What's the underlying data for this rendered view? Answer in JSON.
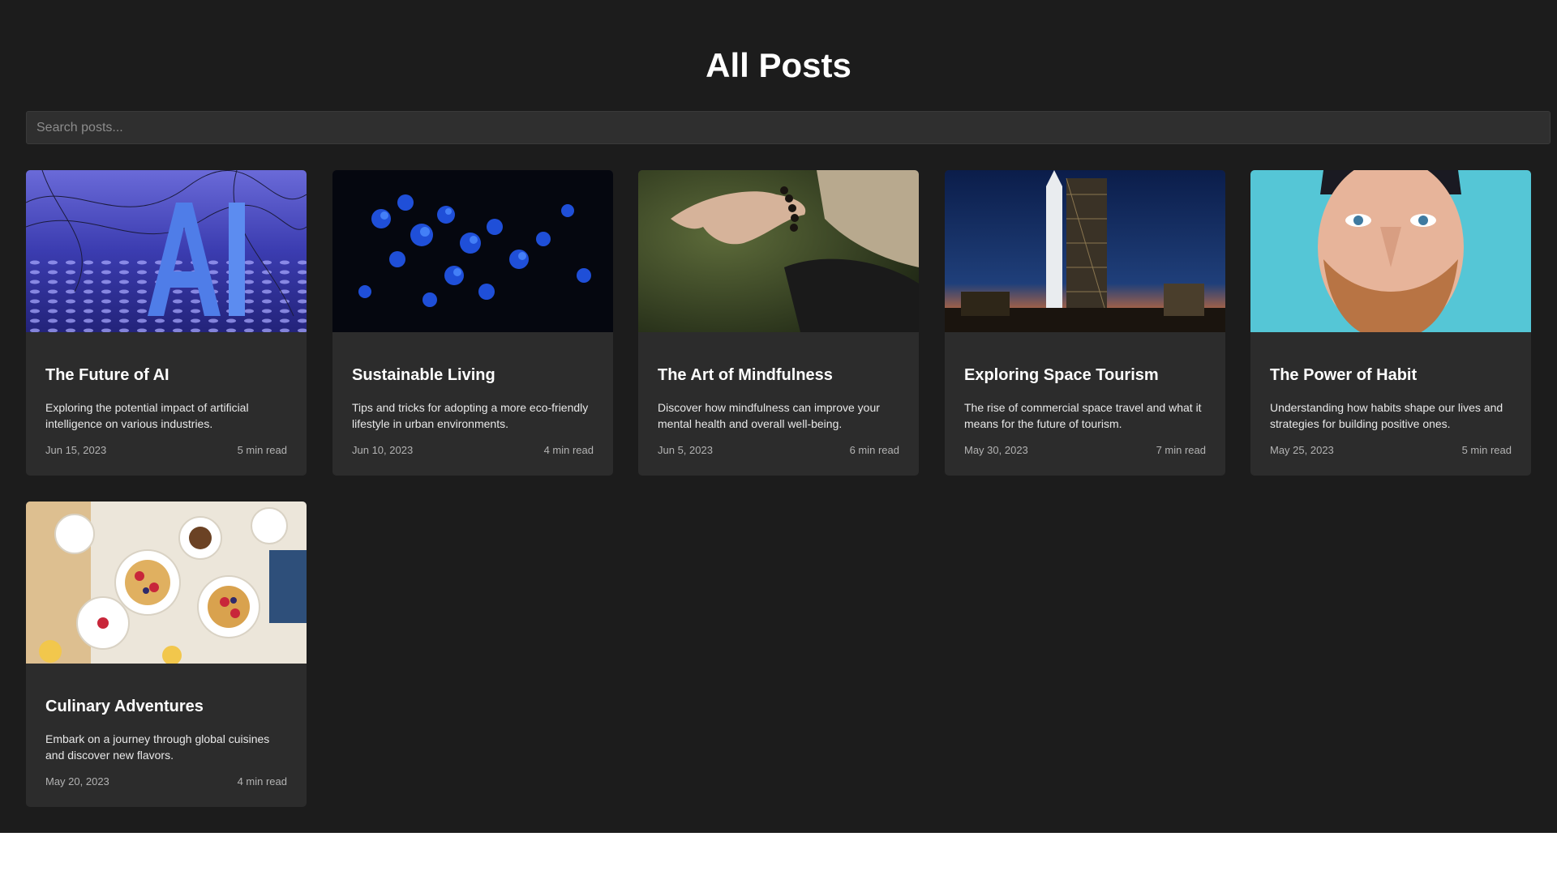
{
  "page": {
    "title": "All Posts"
  },
  "search": {
    "placeholder": "Search posts..."
  },
  "posts": [
    {
      "title": "The Future of AI",
      "description": "Exploring the potential impact of artificial intelligence on various industries.",
      "date": "Jun 15, 2023",
      "read_time": "5 min read",
      "image": "ai-letters-image"
    },
    {
      "title": "Sustainable Living",
      "description": "Tips and tricks for adopting a more eco-friendly lifestyle in urban environments.",
      "date": "Jun 10, 2023",
      "read_time": "4 min read",
      "image": "blue-flowers-image"
    },
    {
      "title": "The Art of Mindfulness",
      "description": "Discover how mindfulness can improve your mental health and overall well-being.",
      "date": "Jun 5, 2023",
      "read_time": "6 min read",
      "image": "meditation-hand-image"
    },
    {
      "title": "Exploring Space Tourism",
      "description": "The rise of commercial space travel and what it means for the future of tourism.",
      "date": "May 30, 2023",
      "read_time": "7 min read",
      "image": "rocket-launch-pad-image"
    },
    {
      "title": "The Power of Habit",
      "description": "Understanding how habits shape our lives and strategies for building positive ones.",
      "date": "May 25, 2023",
      "read_time": "5 min read",
      "image": "bearded-man-portrait-image"
    },
    {
      "title": "Culinary Adventures",
      "description": "Embark on a journey through global cuisines and discover new flavors.",
      "date": "May 20, 2023",
      "read_time": "4 min read",
      "image": "breakfast-table-image"
    }
  ],
  "colors": {
    "background": "#1c1c1c",
    "card": "#2c2c2c",
    "search": "#2f2f2f",
    "text": "#ffffff",
    "muted": "#b3b3b3"
  }
}
